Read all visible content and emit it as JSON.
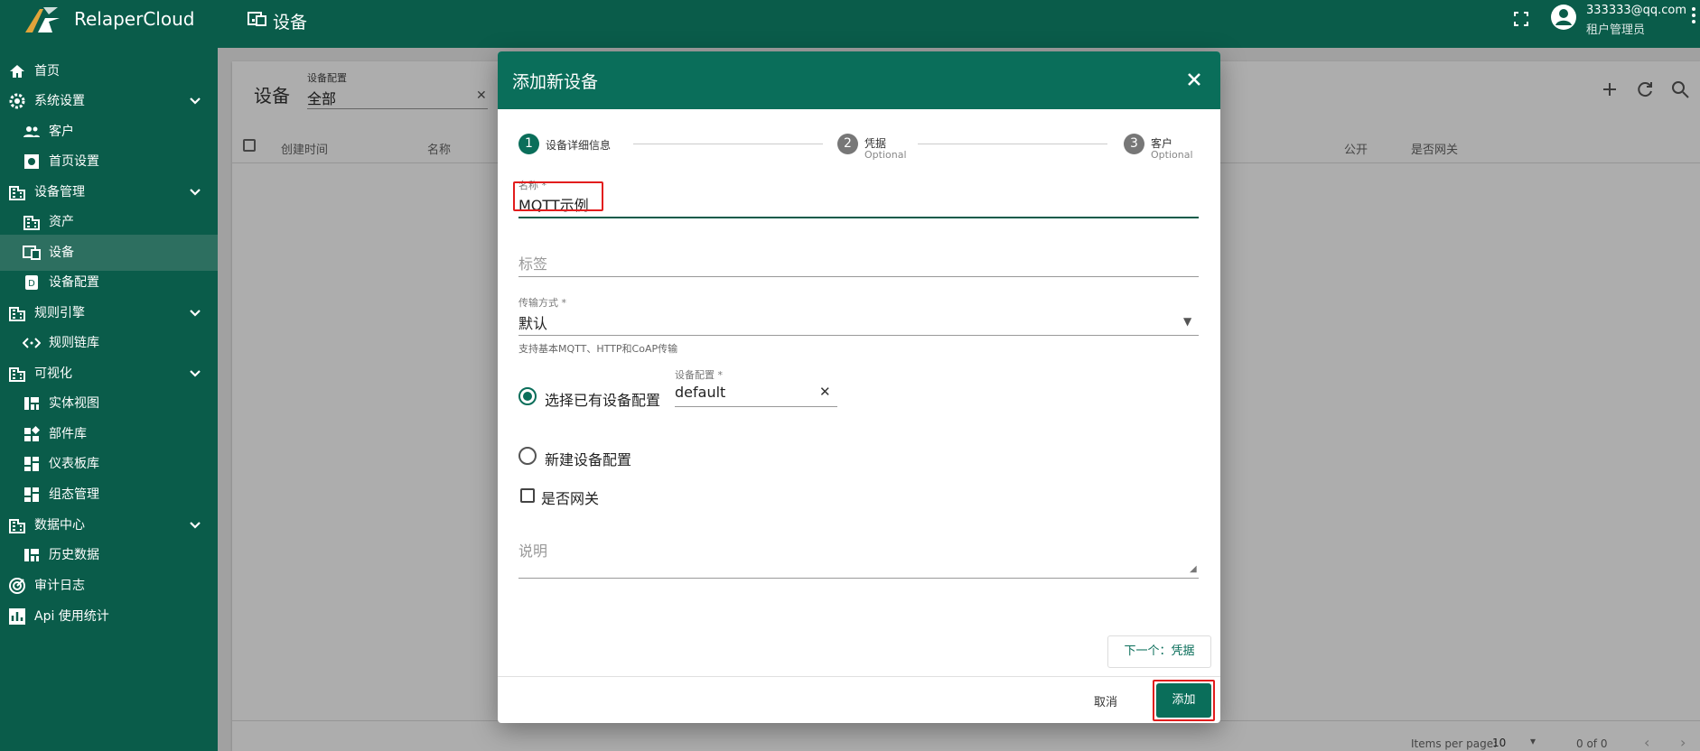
{
  "topbar": {
    "brand": "RelaperCloud",
    "page_title": "设备",
    "user_email": "333333@qq.com",
    "user_role": "租户管理员"
  },
  "sidebar": {
    "items": [
      {
        "label": "首页",
        "icon": "home-icon",
        "level": "top"
      },
      {
        "label": "系统设置",
        "icon": "gear-icon",
        "level": "top",
        "expanded": true
      },
      {
        "label": "客户",
        "icon": "people-icon",
        "level": "sub"
      },
      {
        "label": "首页设置",
        "icon": "settings-box-icon",
        "level": "sub"
      },
      {
        "label": "设备管理",
        "icon": "building-icon",
        "level": "top",
        "expanded": true
      },
      {
        "label": "资产",
        "icon": "building-icon",
        "level": "sub"
      },
      {
        "label": "设备",
        "icon": "devices-icon",
        "level": "sub",
        "active": true
      },
      {
        "label": "设备配置",
        "icon": "device-profile-icon",
        "level": "sub"
      },
      {
        "label": "规则引擎",
        "icon": "building-icon",
        "level": "top",
        "expanded": true
      },
      {
        "label": "规则链库",
        "icon": "code-arrows-icon",
        "level": "sub"
      },
      {
        "label": "可视化",
        "icon": "building-icon",
        "level": "top",
        "expanded": true
      },
      {
        "label": "实体视图",
        "icon": "view-quilt-icon",
        "level": "sub"
      },
      {
        "label": "部件库",
        "icon": "widgets-icon",
        "level": "sub"
      },
      {
        "label": "仪表板库",
        "icon": "dashboard-icon",
        "level": "sub"
      },
      {
        "label": "组态管理",
        "icon": "dashboard-icon",
        "level": "sub"
      },
      {
        "label": "数据中心",
        "icon": "building-icon",
        "level": "top",
        "expanded": true
      },
      {
        "label": "历史数据",
        "icon": "view-quilt-icon",
        "level": "sub"
      },
      {
        "label": "审计日志",
        "icon": "track-changes-icon",
        "level": "top"
      },
      {
        "label": "Api 使用统计",
        "icon": "bar-chart-icon",
        "level": "top"
      }
    ]
  },
  "background": {
    "title": "设备",
    "filter_label": "设备配置",
    "filter_value": "全部",
    "columns": [
      "创建时间",
      "名称",
      "公开",
      "是否网关"
    ],
    "items_per_page_label": "Items per page:",
    "items_per_page_value": "10",
    "range_label": "0 of 0"
  },
  "dialog": {
    "title": "添加新设备",
    "steps": [
      {
        "num": "1",
        "label": "设备详细信息",
        "optional": ""
      },
      {
        "num": "2",
        "label": "凭据",
        "optional": "Optional"
      },
      {
        "num": "3",
        "label": "客户",
        "optional": "Optional"
      }
    ],
    "name_label": "名称 *",
    "name_value": "MQTT示例",
    "label_placeholder": "标签",
    "transport_label": "传输方式 *",
    "transport_value": "默认",
    "transport_hint": "支持基本MQTT、HTTP和CoAP传输",
    "radio_existing_label": "选择已有设备配置",
    "profile_label": "设备配置 *",
    "profile_value": "default",
    "radio_new_label": "新建设备配置",
    "gateway_label": "是否网关",
    "description_placeholder": "说明",
    "next_button": "下一个：凭据",
    "cancel_button": "取消",
    "add_button": "添加"
  },
  "colors": {
    "primary": "#0a5c4a",
    "dialog_header": "#0a6e5a",
    "highlight": "#e21d1d"
  }
}
